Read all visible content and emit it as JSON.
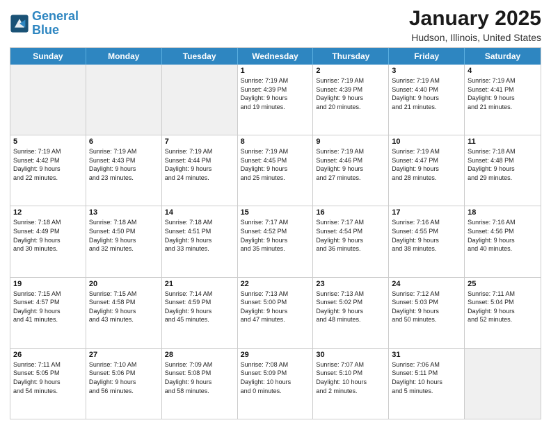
{
  "logo": {
    "line1": "General",
    "line2": "Blue"
  },
  "title": "January 2025",
  "subtitle": "Hudson, Illinois, United States",
  "days_of_week": [
    "Sunday",
    "Monday",
    "Tuesday",
    "Wednesday",
    "Thursday",
    "Friday",
    "Saturday"
  ],
  "weeks": [
    [
      {
        "day": "",
        "info": "",
        "shaded": true
      },
      {
        "day": "",
        "info": "",
        "shaded": true
      },
      {
        "day": "",
        "info": "",
        "shaded": true
      },
      {
        "day": "1",
        "info": "Sunrise: 7:19 AM\nSunset: 4:39 PM\nDaylight: 9 hours\nand 19 minutes."
      },
      {
        "day": "2",
        "info": "Sunrise: 7:19 AM\nSunset: 4:39 PM\nDaylight: 9 hours\nand 20 minutes."
      },
      {
        "day": "3",
        "info": "Sunrise: 7:19 AM\nSunset: 4:40 PM\nDaylight: 9 hours\nand 21 minutes."
      },
      {
        "day": "4",
        "info": "Sunrise: 7:19 AM\nSunset: 4:41 PM\nDaylight: 9 hours\nand 21 minutes."
      }
    ],
    [
      {
        "day": "5",
        "info": "Sunrise: 7:19 AM\nSunset: 4:42 PM\nDaylight: 9 hours\nand 22 minutes."
      },
      {
        "day": "6",
        "info": "Sunrise: 7:19 AM\nSunset: 4:43 PM\nDaylight: 9 hours\nand 23 minutes."
      },
      {
        "day": "7",
        "info": "Sunrise: 7:19 AM\nSunset: 4:44 PM\nDaylight: 9 hours\nand 24 minutes."
      },
      {
        "day": "8",
        "info": "Sunrise: 7:19 AM\nSunset: 4:45 PM\nDaylight: 9 hours\nand 25 minutes."
      },
      {
        "day": "9",
        "info": "Sunrise: 7:19 AM\nSunset: 4:46 PM\nDaylight: 9 hours\nand 27 minutes."
      },
      {
        "day": "10",
        "info": "Sunrise: 7:19 AM\nSunset: 4:47 PM\nDaylight: 9 hours\nand 28 minutes."
      },
      {
        "day": "11",
        "info": "Sunrise: 7:18 AM\nSunset: 4:48 PM\nDaylight: 9 hours\nand 29 minutes."
      }
    ],
    [
      {
        "day": "12",
        "info": "Sunrise: 7:18 AM\nSunset: 4:49 PM\nDaylight: 9 hours\nand 30 minutes."
      },
      {
        "day": "13",
        "info": "Sunrise: 7:18 AM\nSunset: 4:50 PM\nDaylight: 9 hours\nand 32 minutes."
      },
      {
        "day": "14",
        "info": "Sunrise: 7:18 AM\nSunset: 4:51 PM\nDaylight: 9 hours\nand 33 minutes."
      },
      {
        "day": "15",
        "info": "Sunrise: 7:17 AM\nSunset: 4:52 PM\nDaylight: 9 hours\nand 35 minutes."
      },
      {
        "day": "16",
        "info": "Sunrise: 7:17 AM\nSunset: 4:54 PM\nDaylight: 9 hours\nand 36 minutes."
      },
      {
        "day": "17",
        "info": "Sunrise: 7:16 AM\nSunset: 4:55 PM\nDaylight: 9 hours\nand 38 minutes."
      },
      {
        "day": "18",
        "info": "Sunrise: 7:16 AM\nSunset: 4:56 PM\nDaylight: 9 hours\nand 40 minutes."
      }
    ],
    [
      {
        "day": "19",
        "info": "Sunrise: 7:15 AM\nSunset: 4:57 PM\nDaylight: 9 hours\nand 41 minutes."
      },
      {
        "day": "20",
        "info": "Sunrise: 7:15 AM\nSunset: 4:58 PM\nDaylight: 9 hours\nand 43 minutes."
      },
      {
        "day": "21",
        "info": "Sunrise: 7:14 AM\nSunset: 4:59 PM\nDaylight: 9 hours\nand 45 minutes."
      },
      {
        "day": "22",
        "info": "Sunrise: 7:13 AM\nSunset: 5:00 PM\nDaylight: 9 hours\nand 47 minutes."
      },
      {
        "day": "23",
        "info": "Sunrise: 7:13 AM\nSunset: 5:02 PM\nDaylight: 9 hours\nand 48 minutes."
      },
      {
        "day": "24",
        "info": "Sunrise: 7:12 AM\nSunset: 5:03 PM\nDaylight: 9 hours\nand 50 minutes."
      },
      {
        "day": "25",
        "info": "Sunrise: 7:11 AM\nSunset: 5:04 PM\nDaylight: 9 hours\nand 52 minutes."
      }
    ],
    [
      {
        "day": "26",
        "info": "Sunrise: 7:11 AM\nSunset: 5:05 PM\nDaylight: 9 hours\nand 54 minutes."
      },
      {
        "day": "27",
        "info": "Sunrise: 7:10 AM\nSunset: 5:06 PM\nDaylight: 9 hours\nand 56 minutes."
      },
      {
        "day": "28",
        "info": "Sunrise: 7:09 AM\nSunset: 5:08 PM\nDaylight: 9 hours\nand 58 minutes."
      },
      {
        "day": "29",
        "info": "Sunrise: 7:08 AM\nSunset: 5:09 PM\nDaylight: 10 hours\nand 0 minutes."
      },
      {
        "day": "30",
        "info": "Sunrise: 7:07 AM\nSunset: 5:10 PM\nDaylight: 10 hours\nand 2 minutes."
      },
      {
        "day": "31",
        "info": "Sunrise: 7:06 AM\nSunset: 5:11 PM\nDaylight: 10 hours\nand 5 minutes."
      },
      {
        "day": "",
        "info": "",
        "shaded": true
      }
    ]
  ]
}
